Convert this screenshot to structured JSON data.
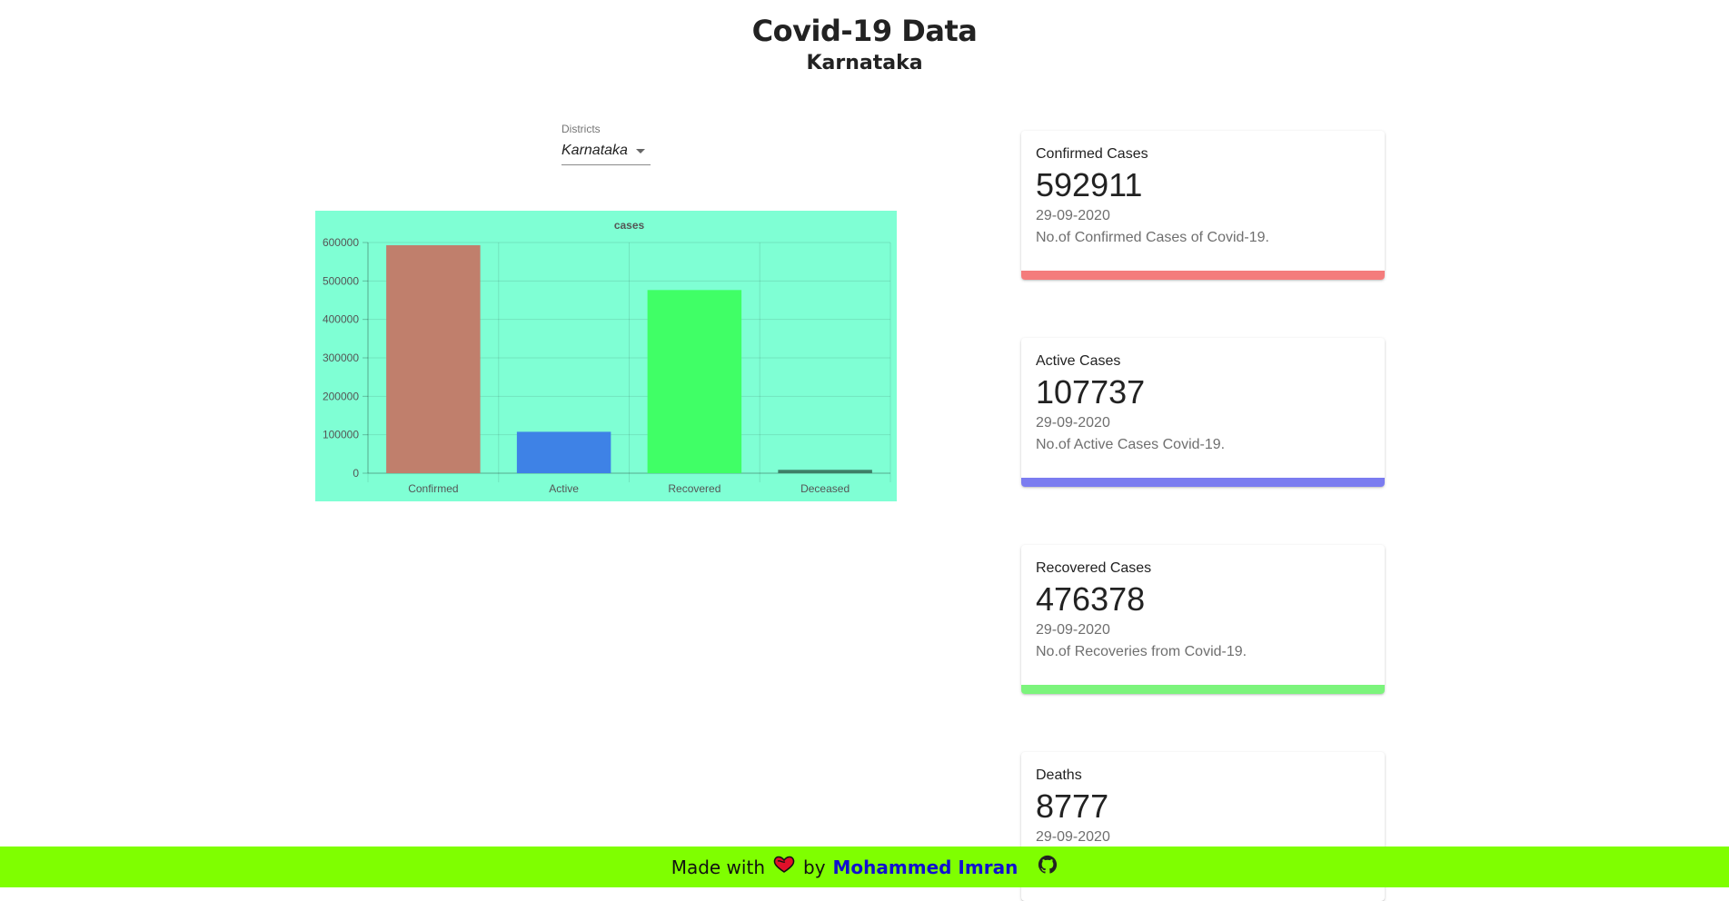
{
  "header": {
    "title": "Covid-19 Data",
    "subtitle": "Karnataka"
  },
  "district_select": {
    "label": "Districts",
    "value": "Karnataka"
  },
  "chart_data": {
    "type": "bar",
    "title": "cases",
    "categories": [
      "Confirmed",
      "Active",
      "Recovered",
      "Deceased"
    ],
    "values": [
      592911,
      107737,
      476378,
      8777
    ],
    "colors": [
      "#c07f6c",
      "#3e82e6",
      "#40ff66",
      "#3d7f67"
    ],
    "ylim": [
      0,
      600000
    ],
    "yticks": [
      "0",
      "100000",
      "200000",
      "300000",
      "400000",
      "500000",
      "600000"
    ],
    "background": "#7fffd4",
    "grid": true
  },
  "cards": [
    {
      "title": "Confirmed Cases",
      "value": "592911",
      "date": "29-09-2020",
      "desc": "No.of Confirmed Cases of Covid-19.",
      "color": "#f47c7c"
    },
    {
      "title": "Active Cases",
      "value": "107737",
      "date": "29-09-2020",
      "desc": "No.of Active Cases Covid-19.",
      "color": "#7b7cf0"
    },
    {
      "title": "Recovered Cases",
      "value": "476378",
      "date": "29-09-2020",
      "desc": "No.of Recoveries from Covid-19.",
      "color": "#7cf47c"
    },
    {
      "title": "Deaths",
      "value": "8777",
      "date": "29-09-2020",
      "desc": "",
      "color": "#b0b0b0"
    }
  ],
  "footer": {
    "made_with": "Made with",
    "by": "by",
    "author": "Mohammed Imran",
    "heart_icon": "heart-icon",
    "github_icon": "github-icon",
    "background": "#7fff00"
  }
}
